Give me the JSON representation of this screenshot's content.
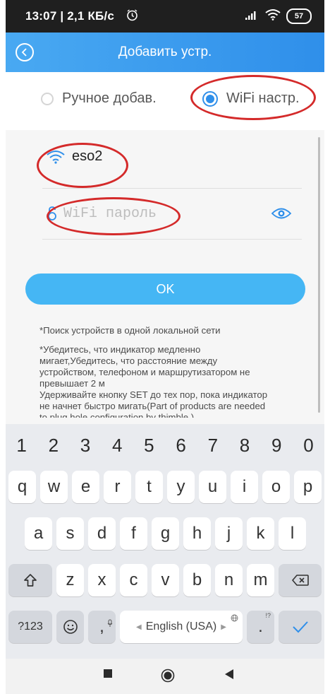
{
  "status_bar": {
    "text": "13:07 | 2,1 КБ/с",
    "battery": "57"
  },
  "header": {
    "title": "Добавить устр."
  },
  "modes": [
    {
      "label": "Ручное добав.",
      "selected": false
    },
    {
      "label": "WiFi настр.",
      "selected": true
    }
  ],
  "wifi": {
    "ssid": "eso2",
    "password_placeholder": "WiFi пароль",
    "password_value": ""
  },
  "ok_button": {
    "label": "OK"
  },
  "hints": {
    "line1": "*Поиск устройств в одной локальной сети",
    "line2": "*Убедитесь, что индикатор медленно\nмигает,Убедитесь, что расстояние между\nустройством, телефоном и маршрутизатором не\nпревышает 2 м\nУдерживайте кнопку SET до тех пор, пока индикатор\nне начнет быстро мигать(Part of products are needed\nto plug hole configuration by thimble.)"
  },
  "keyboard": {
    "numbers": [
      "1",
      "2",
      "3",
      "4",
      "5",
      "6",
      "7",
      "8",
      "9",
      "0"
    ],
    "row1": [
      "q",
      "w",
      "e",
      "r",
      "t",
      "y",
      "u",
      "i",
      "o",
      "p"
    ],
    "row2": [
      "a",
      "s",
      "d",
      "f",
      "g",
      "h",
      "j",
      "k",
      "l"
    ],
    "row3": [
      "z",
      "x",
      "c",
      "v",
      "b",
      "n",
      "m"
    ],
    "symbols_key": "?123",
    "comma_key": ",",
    "period_key": ".",
    "space_label": "English (USA)",
    "period_hint": "!?"
  },
  "colors": {
    "accent": "#2f8fea",
    "header_start": "#49a9f2",
    "ok_button": "#45b6f4",
    "annotation": "#d42a2a"
  }
}
